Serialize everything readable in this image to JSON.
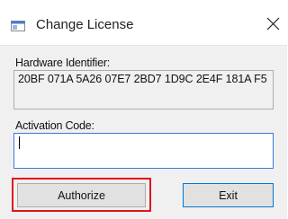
{
  "window": {
    "title": "Change License",
    "close_icon": "close-icon",
    "app_icon": "window-app-icon"
  },
  "hardware": {
    "label": "Hardware Identifier:",
    "value": "20BF 071A 5A26 07E7 2BD7 1D9C 2E4F 181A F5"
  },
  "activation": {
    "label": "Activation Code:",
    "value": ""
  },
  "buttons": {
    "authorize": "Authorize",
    "exit": "Exit"
  },
  "colors": {
    "highlight": "#e0141e",
    "focus_border": "#3c78d8"
  }
}
